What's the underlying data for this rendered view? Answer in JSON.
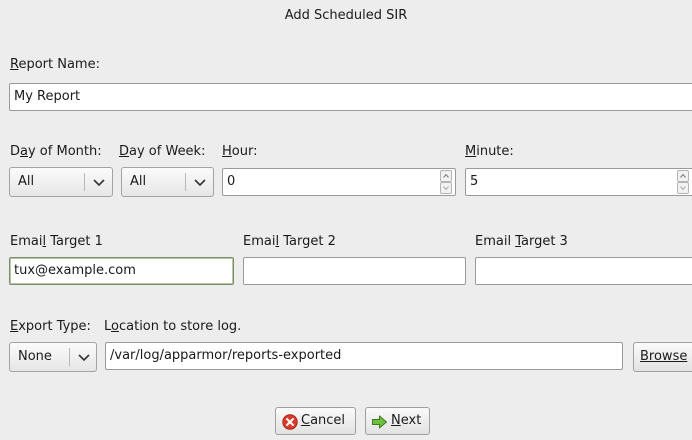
{
  "window": {
    "title": "Add Scheduled SIR"
  },
  "report_name": {
    "label_mnemonic": "R",
    "label_rest": "eport Name:",
    "value": "My Report"
  },
  "schedule": {
    "day_of_month": {
      "label_pre": "D",
      "label_mn": "a",
      "label_post": "y of Month:",
      "value": "All"
    },
    "day_of_week": {
      "label_mn": "D",
      "label_post": "ay of Week:",
      "value": "All"
    },
    "hour": {
      "label_mn": "H",
      "label_post": "our:",
      "value": "0"
    },
    "minute": {
      "label_mn": "M",
      "label_post": "inute:",
      "value": "5"
    }
  },
  "email": {
    "target1": {
      "label_pre": "Emai",
      "label_mn": "l",
      "label_post": " Target 1",
      "value": "tux@example.com"
    },
    "target2": {
      "label_pre": "Emai",
      "label_mn": "l",
      "label_post": " Target 2",
      "value": ""
    },
    "target3": {
      "label_pre": "Email ",
      "label_mn": "T",
      "label_post": "arget 3",
      "value": ""
    }
  },
  "export": {
    "type_label_mn": "E",
    "type_label_post": "xport Type:",
    "type_value": "None",
    "location_label_pre": "L",
    "location_label_mn": "o",
    "location_label_post": "cation to store log.",
    "location_value": "/var/log/apparmor/reports-exported",
    "browse_label": "Browse"
  },
  "buttons": {
    "cancel_mn": "C",
    "cancel_rest": "ancel",
    "next_mn": "N",
    "next_rest": "ext"
  },
  "icons": {
    "cancel": "cancel-icon",
    "next": "next-arrow-icon",
    "dropdown": "chevron-down-icon"
  }
}
